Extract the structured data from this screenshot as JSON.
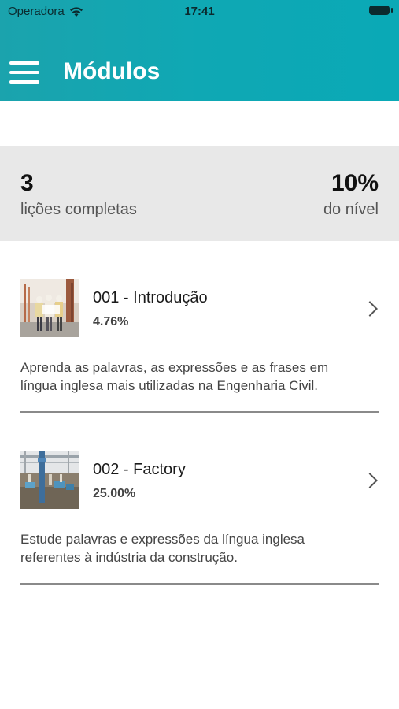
{
  "status": {
    "carrier": "Operadora",
    "time": "17:41"
  },
  "header": {
    "title": "Módulos"
  },
  "stats": {
    "lessons_value": "3",
    "lessons_label": "lições completas",
    "level_value": "10%",
    "level_label": "do nível"
  },
  "modules": [
    {
      "title": "001 - Introdução",
      "percent": "4.76%",
      "description": "Aprenda as palavras, as expressões e as frases em língua inglesa mais utilizadas na Engenharia Civil."
    },
    {
      "title": "002 - Factory",
      "percent": "25.00%",
      "description": "Estude palavras e expressões da língua inglesa referentes à indústria da construção."
    }
  ],
  "colors": {
    "header": "#0fa8b4",
    "stats_bg": "#e8e8e8"
  }
}
